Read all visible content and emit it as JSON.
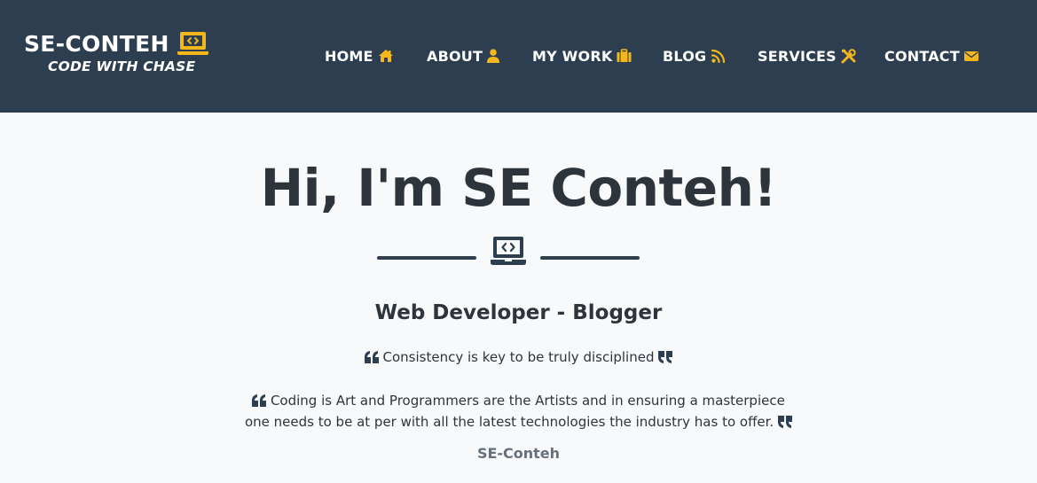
{
  "brand": {
    "title": "SE-CONTEH",
    "icon": "laptop-code-icon",
    "subtitle": "CODE WITH CHASE"
  },
  "nav": {
    "items": [
      {
        "label": "HOME",
        "icon": "home-icon"
      },
      {
        "label": "ABOUT",
        "icon": "user-icon"
      },
      {
        "label": "MY WORK",
        "icon": "suitcase-icon"
      },
      {
        "label": "BLOG",
        "icon": "rss-icon"
      },
      {
        "label": "SERVICES",
        "icon": "tools-icon"
      },
      {
        "label": "CONTACT",
        "icon": "envelope-icon"
      }
    ]
  },
  "hero": {
    "title": "Hi, I'm SE Conteh!",
    "divider_icon": "laptop-code-icon",
    "subtitle": "Web Developer - Blogger",
    "quote1": "Consistency is key to be truly disciplined",
    "quote2_line1": "Coding is Art and Programmers are the Artists and in ensuring a masterpiece",
    "quote2_line2": "one needs to be at per with all the latest technologies the industry has to offer.",
    "author": "SE-Conteh"
  },
  "colors": {
    "navbar_bg": "#2c3e50",
    "accent": "#f3b71b",
    "page_bg": "#f7f9fb",
    "heading_text": "#2e343c",
    "author_text": "#66707d"
  }
}
